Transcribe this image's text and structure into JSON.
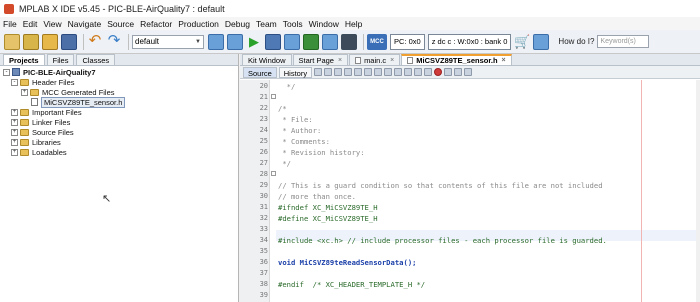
{
  "window": {
    "title": "MPLAB X IDE v5.45 - PIC-BLE-AirQuality7 : default"
  },
  "menu": [
    "File",
    "Edit",
    "View",
    "Navigate",
    "Source",
    "Refactor",
    "Production",
    "Debug",
    "Team",
    "Tools",
    "Window",
    "Help"
  ],
  "toolbar": {
    "config_value": "default",
    "pc_label": "PC: 0x0",
    "status_label": "z dc c  : W:0x0 : bank 0",
    "mcc_label": "MCC",
    "howdoi_label": "How do I?",
    "keyword_placeholder": "Keyword(s)"
  },
  "left_tabs": [
    "Projects",
    "Files",
    "Classes"
  ],
  "tree": {
    "project": "PIC-BLE-AirQuality7",
    "header_files": "Header Files",
    "mcc_generated": "MCC Generated Files",
    "sensor_file": "MiCSVZ89TE_sensor.h",
    "important_files": "Important Files",
    "linker_files": "Linker Files",
    "source_files": "Source Files",
    "libraries": "Libraries",
    "loadables": "Loadables"
  },
  "doc_tabs": [
    "Kit Window",
    "Start Page",
    "main.c",
    "MiCSVZ89TE_sensor.h"
  ],
  "editor_tabs": [
    "Source",
    "History"
  ],
  "code_lines": [
    {
      "n": "20",
      "t": "  */",
      "cls": "c-comment"
    },
    {
      "n": "21",
      "t": "",
      "cls": ""
    },
    {
      "n": "22",
      "t": "/*",
      "cls": "c-comment"
    },
    {
      "n": "23",
      "t": " * File:",
      "cls": "c-comment"
    },
    {
      "n": "24",
      "t": " * Author:",
      "cls": "c-comment"
    },
    {
      "n": "25",
      "t": " * Comments:",
      "cls": "c-comment"
    },
    {
      "n": "26",
      "t": " * Revision history:",
      "cls": "c-comment"
    },
    {
      "n": "27",
      "t": " */",
      "cls": "c-comment"
    },
    {
      "n": "28",
      "t": "",
      "cls": ""
    },
    {
      "n": "29",
      "t": "// This is a guard condition so that contents of this file are not included",
      "cls": "c-comment"
    },
    {
      "n": "30",
      "t": "// more than once.",
      "cls": "c-comment"
    },
    {
      "n": "31",
      "t": "#ifndef XC_MiCSVZ89TE_H",
      "cls": "c-dir"
    },
    {
      "n": "32",
      "t": "#define XC_MiCSVZ89TE_H",
      "cls": "c-dir"
    },
    {
      "n": "33",
      "t": "",
      "cls": ""
    },
    {
      "n": "34",
      "t": "#include <xc.h> // include processor files - each processor file is guarded.",
      "cls": "c-dir"
    },
    {
      "n": "35",
      "t": "",
      "cls": ""
    },
    {
      "n": "36",
      "t": "void MiCSVZ89teReadSensorData();",
      "cls": "c-kw"
    },
    {
      "n": "37",
      "t": "",
      "cls": ""
    },
    {
      "n": "38",
      "t": "#endif  /* XC_HEADER_TEMPLATE_H */",
      "cls": "c-dir"
    },
    {
      "n": "39",
      "t": "",
      "cls": ""
    }
  ]
}
